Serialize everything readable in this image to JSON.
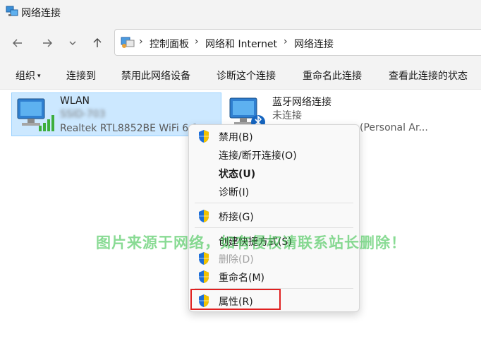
{
  "window": {
    "title": "网络连接",
    "title_icon": "network-connections-icon"
  },
  "nav": {
    "back_icon": "back-arrow-icon",
    "forward_icon": "forward-arrow-icon",
    "recent_icon": "chevron-down-icon",
    "up_icon": "up-arrow-icon"
  },
  "address": {
    "icon": "control-panel-icon",
    "crumbs": [
      "控制面板",
      "网络和 Internet",
      "网络连接"
    ],
    "separator": "›"
  },
  "commands": {
    "organize": "组织",
    "connect_to": "连接到",
    "disable_device": "禁用此网络设备",
    "diagnose": "诊断这个连接",
    "rename": "重命名此连接",
    "view_status": "查看此连接的状态"
  },
  "connections": [
    {
      "name": "WLAN",
      "network": "SSID-703",
      "adapter": "Realtek RTL8852BE WiFi 6 8",
      "icon": "wifi-adapter-icon",
      "selected": true
    },
    {
      "name": "蓝牙网络连接",
      "status": "未连接",
      "adapter": "(Personal Ar...",
      "icon": "bluetooth-adapter-icon",
      "selected": false
    }
  ],
  "context_menu": {
    "items": [
      {
        "label": "禁用(B)",
        "shield": true,
        "bold": false,
        "disabled": false
      },
      {
        "label": "连接/断开连接(O)",
        "shield": false,
        "bold": false,
        "disabled": false
      },
      {
        "label": "状态(U)",
        "shield": false,
        "bold": true,
        "disabled": false
      },
      {
        "label": "诊断(I)",
        "shield": false,
        "bold": false,
        "disabled": false
      },
      {
        "label": "桥接(G)",
        "shield": true,
        "bold": false,
        "disabled": false
      },
      {
        "label": "创建快捷方式(S)",
        "shield": false,
        "bold": false,
        "disabled": false
      },
      {
        "label": "删除(D)",
        "shield": true,
        "bold": false,
        "disabled": true
      },
      {
        "label": "重命名(M)",
        "shield": true,
        "bold": false,
        "disabled": false
      },
      {
        "label": "属性(R)",
        "shield": true,
        "bold": false,
        "disabled": false,
        "highlighted": true
      }
    ],
    "highlight_color": "#e02020"
  },
  "watermark": {
    "text": "图片来源于网络，如有侵权请联系站长删除！",
    "color": "#28be3c"
  },
  "colors": {
    "selection": "#cce8ff",
    "selection_border": "#99d1ff",
    "shield_blue": "#1e6fd9",
    "shield_yellow": "#f2c200"
  }
}
